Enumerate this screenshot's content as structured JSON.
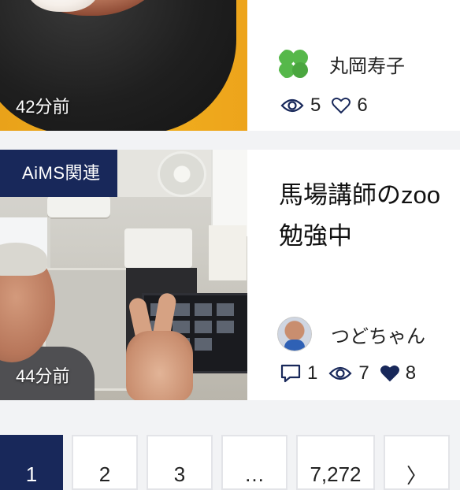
{
  "posts": [
    {
      "time": "42分前",
      "author": "丸岡寿子",
      "views": "5",
      "likes": "6"
    },
    {
      "category": "AiMS関連",
      "title_line1": "馬場講師のzoo",
      "title_line2": "勉強中",
      "time": "44分前",
      "author": "つどちゃん",
      "comments": "1",
      "views": "7",
      "likes": "8"
    }
  ],
  "pagination": {
    "pages": [
      "1",
      "2",
      "3",
      "…",
      "7,272"
    ],
    "next": "〉",
    "current": "1"
  },
  "colors": {
    "accent_navy": "#18285a",
    "liked_heart": "#18285a"
  },
  "icons": {
    "views": "eye-icon",
    "likes": "heart-icon",
    "comments": "comment-icon",
    "next": "chevron-right-icon"
  }
}
